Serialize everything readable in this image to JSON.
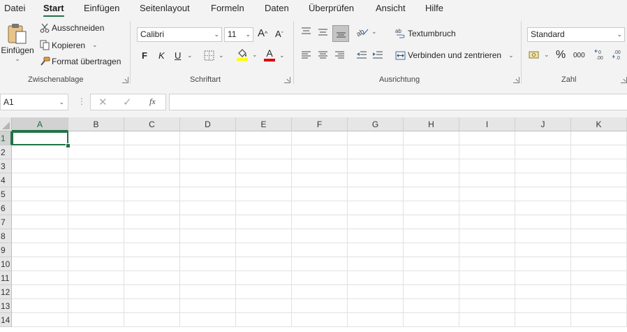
{
  "menu": {
    "tabs": [
      "Datei",
      "Start",
      "Einfügen",
      "Seitenlayout",
      "Formeln",
      "Daten",
      "Überprüfen",
      "Ansicht",
      "Hilfe"
    ],
    "active": "Start"
  },
  "clipboard": {
    "paste_label": "Einfügen",
    "cut_label": "Ausschneiden",
    "copy_label": "Kopieren",
    "format_painter_label": "Format übertragen",
    "group_label": "Zwischenablage"
  },
  "font": {
    "font_name": "Calibri",
    "font_size": "11",
    "bold_label": "F",
    "italic_label": "K",
    "underline_label": "U",
    "font_color_label": "A",
    "group_label": "Schriftart",
    "highlight_color": "#ffff00",
    "font_color": "#e00000"
  },
  "alignment": {
    "wrap_text_label": "Textumbruch",
    "merge_center_label": "Verbinden und zentrieren",
    "group_label": "Ausrichtung"
  },
  "number": {
    "format": "Standard",
    "percent_label": "%",
    "thousands_label": "000",
    "group_label": "Zahl"
  },
  "formula_bar": {
    "name_box": "A1",
    "fx_label": "fx",
    "formula": ""
  },
  "sheet": {
    "columns": [
      "A",
      "B",
      "C",
      "D",
      "E",
      "F",
      "G",
      "H",
      "I",
      "J",
      "K"
    ],
    "rows": [
      "1",
      "2",
      "3",
      "4",
      "5",
      "6",
      "7",
      "8",
      "9",
      "10",
      "11",
      "12",
      "13",
      "14"
    ],
    "active_cell": "A1",
    "accent_color": "#217346"
  }
}
